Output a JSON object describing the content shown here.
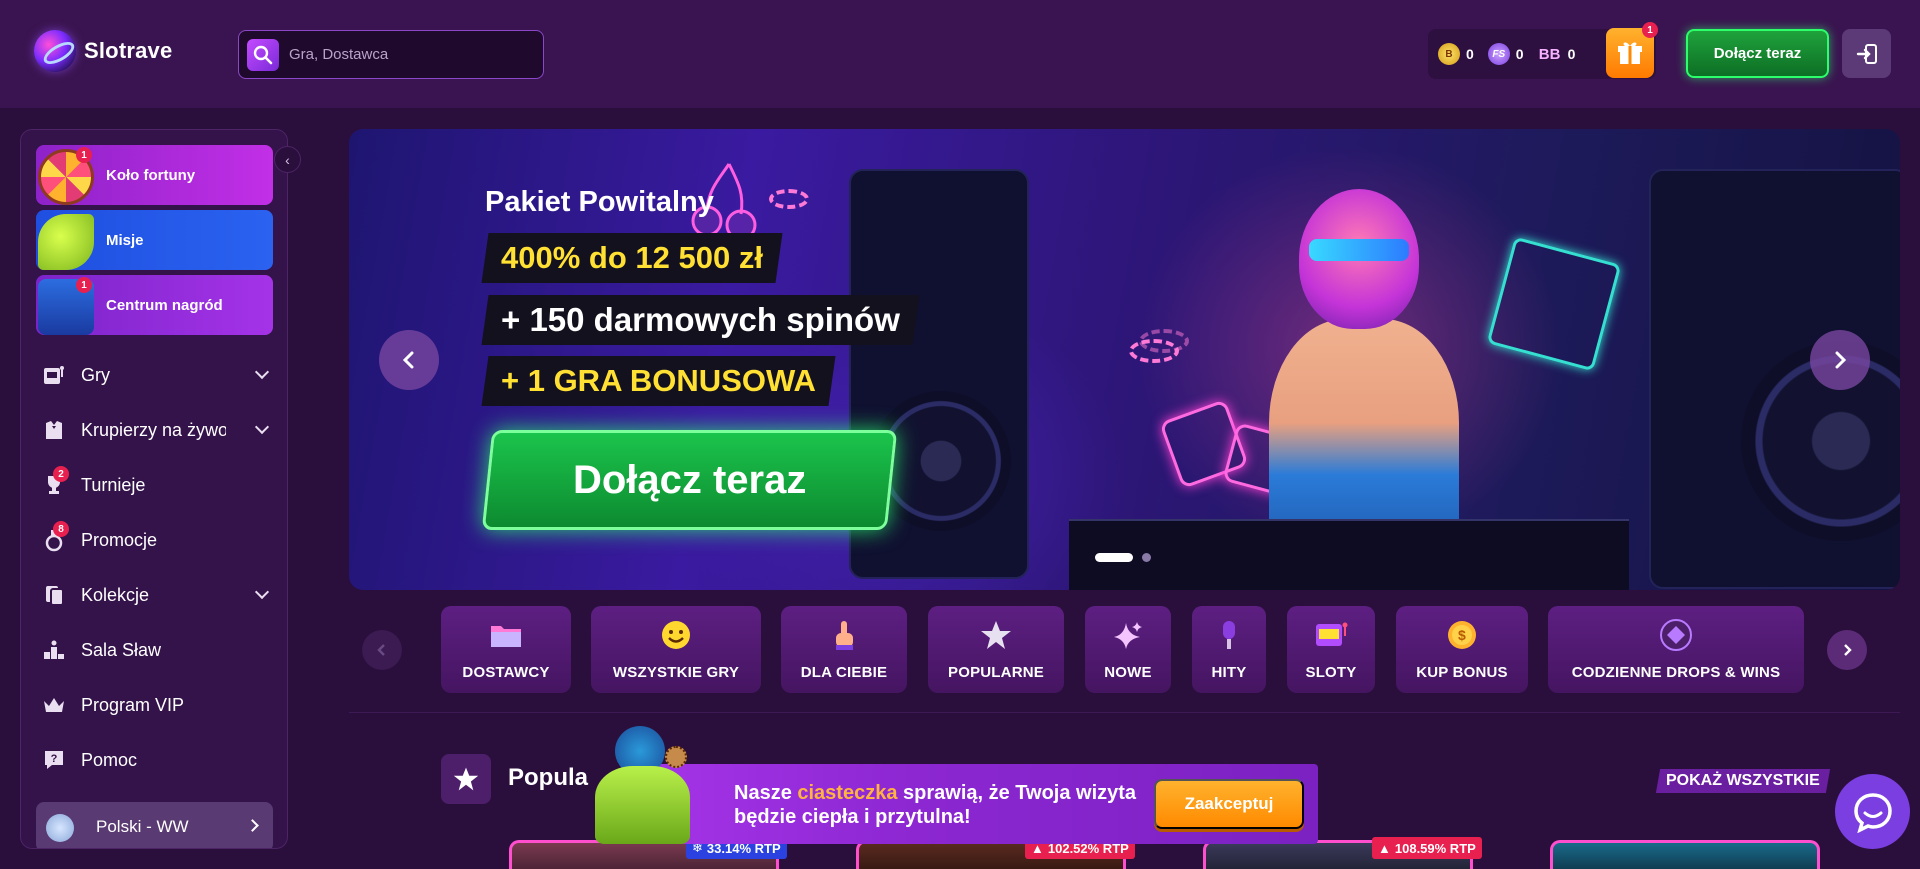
{
  "brand": {
    "name": "Slotrave"
  },
  "search": {
    "placeholder": "Gra, Dostawca"
  },
  "wallet": {
    "items": [
      {
        "icon": "bonus-coin-icon",
        "value": "0"
      },
      {
        "icon": "free-spins-coin-icon",
        "value": "0"
      },
      {
        "icon": "bb-coin-icon",
        "value": "0"
      }
    ],
    "coin_labels": {
      "fs": "FS",
      "bb": "BB",
      "b": "B"
    },
    "gift_badge": "1"
  },
  "header": {
    "join_label": "Dołącz teraz"
  },
  "sidebar": {
    "promo_cards": [
      {
        "label": "Koło fortuny",
        "badge": "1"
      },
      {
        "label": "Misje"
      },
      {
        "label": "Centrum nagród",
        "badge": "1"
      }
    ],
    "nav": [
      {
        "label": "Gry"
      },
      {
        "label": "Krupierzy na żywo"
      },
      {
        "label": "Turnieje",
        "badge": "2"
      },
      {
        "label": "Promocje",
        "badge": "8"
      },
      {
        "label": "Kolekcje"
      },
      {
        "label": "Sala Sław"
      },
      {
        "label": "Program VIP"
      },
      {
        "label": "Pomoc"
      }
    ],
    "language": "Polski - WW"
  },
  "hero": {
    "title": "Pakiet Powitalny",
    "line1": "400% do 12 500 zł",
    "line2": "+ 150 darmowych spinów",
    "line3": "+ 1 GRA BONUSOWA",
    "cta": "Dołącz teraz"
  },
  "categories": [
    {
      "label": "DOSTAWCY",
      "icon": "folder-icon"
    },
    {
      "label": "WSZYSTKIE GRY",
      "icon": "smiley-icon"
    },
    {
      "label": "DLA CIEBIE",
      "icon": "pointing-hand-icon"
    },
    {
      "label": "POPULARNE",
      "icon": "star-icon"
    },
    {
      "label": "NOWE",
      "icon": "sparkle-icon"
    },
    {
      "label": "HITY",
      "icon": "microphone-icon"
    },
    {
      "label": "SLOTY",
      "icon": "slot-machine-icon"
    },
    {
      "label": "KUP BONUS",
      "icon": "coin-icon"
    },
    {
      "label": "CODZIENNE DROPS & WINS",
      "icon": "drops-wins-icon"
    }
  ],
  "popular": {
    "title": "Popula",
    "show_all": "POKAŻ WSZYSTKIE",
    "rtp_badges": [
      "33.14% RTP",
      "102.52% RTP",
      "108.59% RTP"
    ]
  },
  "cookie": {
    "text_before": "Nasze ",
    "highlight": "ciasteczka",
    "text_after": " sprawią, że Twoja wizyta będzie ciepła i przytulna!",
    "accept": "Zaakceptuj"
  },
  "colors": {
    "background": "#2a0f3d",
    "header": "#3a1450",
    "accent_green": "#2bff6a",
    "accent_orange": "#ff8a00",
    "accent_yellow": "#ffe033",
    "badge_red": "#e8204f"
  }
}
